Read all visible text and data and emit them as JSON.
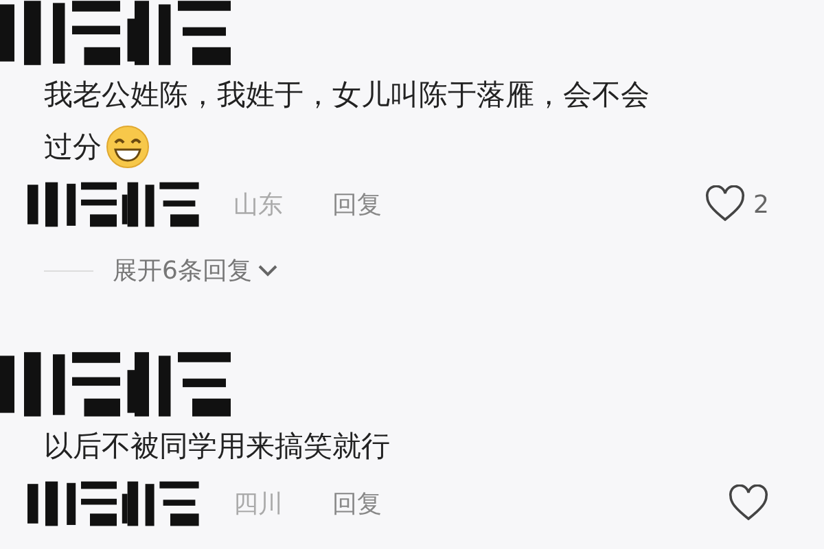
{
  "comments": [
    {
      "lines": [
        "我老公姓陈，我姓于，女儿叫陈于落雁，会不会",
        "过分"
      ],
      "emoji": true,
      "location": "山东",
      "reply": "回复",
      "likes": "2",
      "replies_toggle": "展开6条回复"
    },
    {
      "lines": [
        "以后不被同学用来搞笑就行"
      ],
      "emoji": false,
      "location": "四川",
      "reply": "回复"
    }
  ]
}
